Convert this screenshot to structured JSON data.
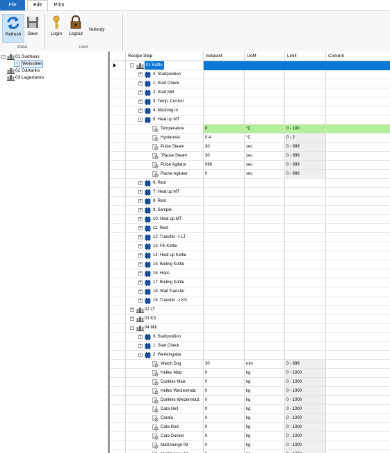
{
  "ribbon": {
    "tabs": [
      "File",
      "Edit",
      "Print"
    ],
    "refresh_label": "Refresh",
    "save_label": "Save",
    "login_label": "Login",
    "logout_label": "Logout",
    "user_name": "Nobody",
    "group_data": "Data",
    "group_user": "User"
  },
  "left_tree": [
    {
      "label": "01 Sudhaus",
      "level": 0,
      "type": "vessel",
      "expander": "-"
    },
    {
      "label": "Weissbier",
      "level": 1,
      "type": "doc",
      "selected": true
    },
    {
      "label": "02 Gärtanks",
      "level": 0,
      "type": "vessel"
    },
    {
      "label": "03 Lagertanks",
      "level": 0,
      "type": "vessel"
    }
  ],
  "grid": {
    "columns": [
      "Recipe Step",
      "Setpoint",
      "UoM",
      "Limit",
      "Coment"
    ],
    "rows": [
      {
        "label": "01 Kettle",
        "level": 0,
        "type": "vessel",
        "exp": "-",
        "sel": true,
        "marker": true
      },
      {
        "label": "0: Startposition",
        "level": 1,
        "type": "step",
        "exp": "+"
      },
      {
        "label": "1: Start Check",
        "level": 1,
        "type": "step",
        "exp": "+"
      },
      {
        "label": "2: Start Mill",
        "level": 1,
        "type": "step",
        "exp": "+"
      },
      {
        "label": "3: Temp. Control",
        "level": 1,
        "type": "step",
        "exp": "+"
      },
      {
        "label": "4: Mashing In",
        "level": 1,
        "type": "step",
        "exp": "+"
      },
      {
        "label": "5: Heat up MT",
        "level": 1,
        "type": "step",
        "exp": "-"
      },
      {
        "label": "Temperature",
        "level": 2,
        "type": "param",
        "setpoint": "0",
        "uom": "°C",
        "limit": "0 - 100",
        "hl": true
      },
      {
        "label": "Hysteresis",
        "level": 2,
        "type": "param",
        "setpoint": "0.4",
        "uom": "°C",
        "limit": "0 - 2"
      },
      {
        "label": "Pulse Steam",
        "level": 2,
        "type": "param",
        "setpoint": "30",
        "uom": "sec",
        "limit": "0 - 999"
      },
      {
        "label": "\"Pause Steam",
        "level": 2,
        "type": "param",
        "setpoint": "30",
        "uom": "sec",
        "limit": "0 - 999"
      },
      {
        "label": "Pulse Agitator",
        "level": 2,
        "type": "param",
        "setpoint": "999",
        "uom": "sec",
        "limit": "0 - 999"
      },
      {
        "label": "Pause Agitator",
        "level": 2,
        "type": "param",
        "setpoint": "0",
        "uom": "sec",
        "limit": "0 - 999"
      },
      {
        "label": "6: Rest",
        "level": 1,
        "type": "step",
        "exp": "+"
      },
      {
        "label": "7: Heat up MT",
        "level": 1,
        "type": "step",
        "exp": "+"
      },
      {
        "label": "8: Rest",
        "level": 1,
        "type": "step",
        "exp": "+"
      },
      {
        "label": "9: Sample",
        "level": 1,
        "type": "step",
        "exp": "+"
      },
      {
        "label": "10: Heat up MT",
        "level": 1,
        "type": "step",
        "exp": "+"
      },
      {
        "label": "11: Rest",
        "level": 1,
        "type": "step",
        "exp": "+"
      },
      {
        "label": "12: Transfer -> LT",
        "level": 1,
        "type": "step",
        "exp": "+"
      },
      {
        "label": "13: Fill Kettle",
        "level": 1,
        "type": "step",
        "exp": "+"
      },
      {
        "label": "14: Heat up Kettle",
        "level": 1,
        "type": "step",
        "exp": "+"
      },
      {
        "label": "15: Boiling Kettle",
        "level": 1,
        "type": "step",
        "exp": "+"
      },
      {
        "label": "16: Hops",
        "level": 1,
        "type": "step",
        "exp": "+"
      },
      {
        "label": "17: Boiling Kettle",
        "level": 1,
        "type": "step",
        "exp": "+"
      },
      {
        "label": "18: Wait Transfer",
        "level": 1,
        "type": "step",
        "exp": "+"
      },
      {
        "label": "19: Transfer -> KS",
        "level": 1,
        "type": "step",
        "exp": "+"
      },
      {
        "label": "02 LT",
        "level": 0,
        "type": "vessel",
        "exp": "+"
      },
      {
        "label": "03 KS",
        "level": 0,
        "type": "vessel",
        "exp": "+"
      },
      {
        "label": "04 Mill",
        "level": 0,
        "type": "vessel",
        "exp": "-"
      },
      {
        "label": "0: Startposition",
        "level": 1,
        "type": "step",
        "exp": "+"
      },
      {
        "label": "1: Start Check",
        "level": 1,
        "type": "step",
        "exp": "+"
      },
      {
        "label": "2: Werteingabe",
        "level": 1,
        "type": "step",
        "exp": "-"
      },
      {
        "label": "Watch Dog",
        "level": 2,
        "type": "param",
        "setpoint": "30",
        "uom": "min",
        "limit": "0 - 999"
      },
      {
        "label": "Helles Malz",
        "level": 2,
        "type": "param",
        "setpoint": "0",
        "uom": "kg",
        "limit": "0 - 1000"
      },
      {
        "label": "Dunkles Malz",
        "level": 2,
        "type": "param",
        "setpoint": "0",
        "uom": "kg",
        "limit": "0 - 1000"
      },
      {
        "label": "Helles Weizenmalz",
        "level": 2,
        "type": "param",
        "setpoint": "0",
        "uom": "kg",
        "limit": "0 - 1000"
      },
      {
        "label": "Dunkles Weizenmalz",
        "level": 2,
        "type": "param",
        "setpoint": "0",
        "uom": "kg",
        "limit": "0 - 1000"
      },
      {
        "label": "Cara Hell",
        "level": 2,
        "type": "param",
        "setpoint": "0",
        "uom": "kg",
        "limit": "0 - 1000"
      },
      {
        "label": "Carafa",
        "level": 2,
        "type": "param",
        "setpoint": "0",
        "uom": "kg",
        "limit": "0 - 1000"
      },
      {
        "label": "Cara Red",
        "level": 2,
        "type": "param",
        "setpoint": "0",
        "uom": "kg",
        "limit": "0 - 1000"
      },
      {
        "label": "Cara Dunkel",
        "level": 2,
        "type": "param",
        "setpoint": "0",
        "uom": "kg",
        "limit": "0 - 1000"
      },
      {
        "label": "Malzmenge 09",
        "level": 2,
        "type": "param",
        "setpoint": "0",
        "uom": "kg",
        "limit": "0 - 1000"
      },
      {
        "label": "Malzmenge 10",
        "level": 2,
        "type": "param",
        "setpoint": "0",
        "uom": "kg",
        "limit": "0 - 1000"
      }
    ]
  },
  "colors": {
    "accent": "#0b78d7",
    "highlight": "#b3f09a",
    "file_tab": "#1f6fc5"
  }
}
